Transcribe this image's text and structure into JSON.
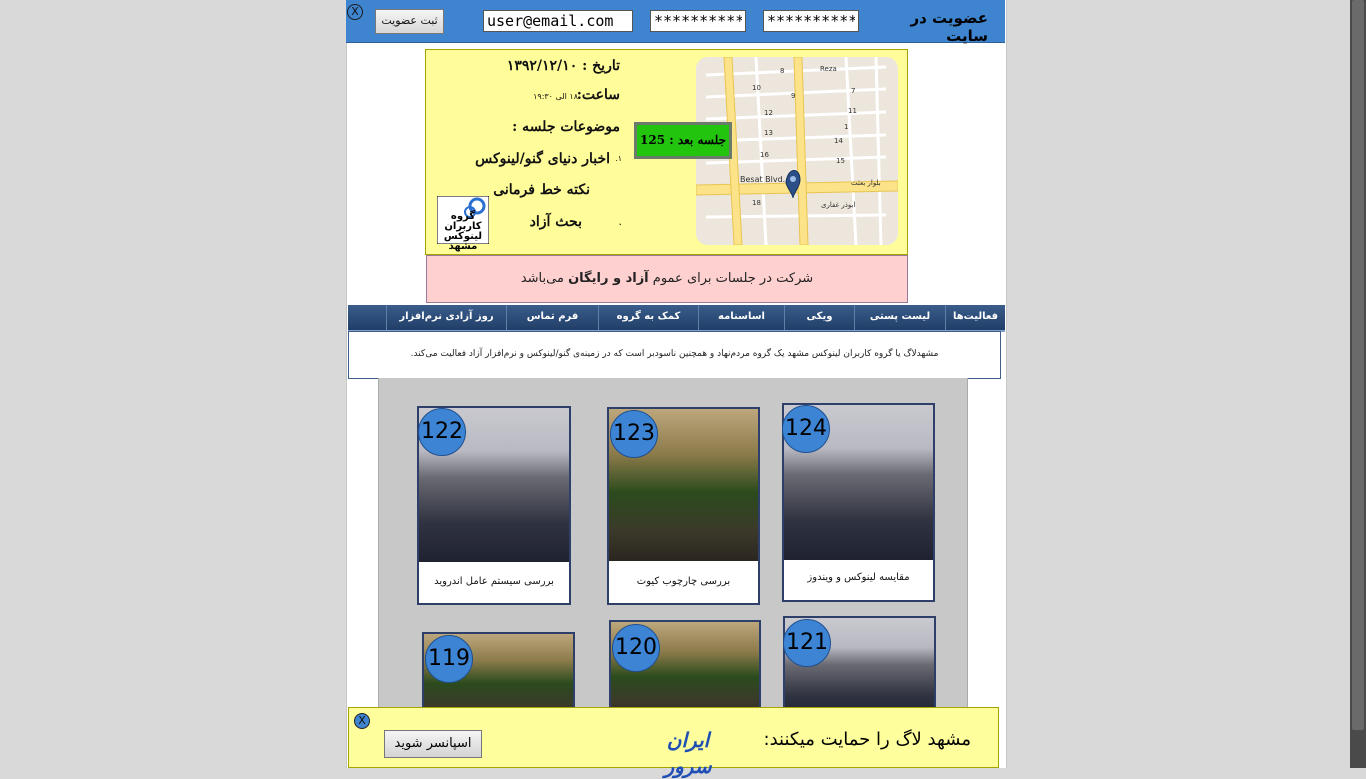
{
  "header": {
    "close_label": "X",
    "register_button": "ثبت عضویت",
    "email_value": "user@email.com",
    "password1_value": "**********",
    "password2_value": "**********",
    "title": "عضویت در سایت"
  },
  "session": {
    "date_label": "تاریخ : ۱۳۹۲/۱۲/۱۰",
    "time_label": "ساعت:",
    "time_value": "۱۸ الی ۱۹:۳۰",
    "topics_label": "موضوعات جلسه :",
    "topic_1": "اخبار دنیای گنو/لینوکس",
    "topic_1_num": "۱.",
    "topic_2": "نکته خط فرمانی",
    "topic_3": "بحث آزاد",
    "topic_3_num": ".",
    "next_session": "جلسه بعد : 125",
    "logo_text": "گروه کاربران لینوکس مشهد"
  },
  "map": {
    "street_1": "Besat Blvd.",
    "street_2": "بلوار بعثت",
    "street_3": "ابوذر غفاری",
    "street_4": "Reza",
    "numbers": [
      "8",
      "10",
      "9",
      "7",
      "12",
      "11",
      "13",
      "14",
      "16",
      "15",
      "18",
      "1"
    ]
  },
  "notice": {
    "text_before": "شرکت در جلسات برای عموم",
    "text_bold": "آزاد و رایگان",
    "text_after": "می‌باشد"
  },
  "nav": {
    "items": [
      "فعالیت‌ها",
      "لیست پستی",
      "ویکی",
      "اساسنامه",
      "کمک به گروه",
      "فرم تماس",
      "روز آزادی نرم‌افزار"
    ]
  },
  "about": {
    "text": "مشهدلاگ یا گروه کاربران لینوکس مشهد یک گروه مردم‌نهاد و همچنین ناسودبر است که در زمینه‌ی گنو/لینوکس و نرم‌افزار آزاد فعالیت می‌کند."
  },
  "gallery": {
    "cards": [
      {
        "number": "122",
        "caption": "بررسی سیستم عامل اندروید"
      },
      {
        "number": "123",
        "caption": "بررسی چارچوب کیوت"
      },
      {
        "number": "124",
        "caption": "مقایسه لینوکس و ویندوز"
      },
      {
        "number": "119",
        "caption": ""
      },
      {
        "number": "120",
        "caption": ""
      },
      {
        "number": "121",
        "caption": ""
      }
    ]
  },
  "sponsor": {
    "close_label": "X",
    "button": "اسپانسر شوید",
    "text": "مشهد لاگ را حمایت میکنند:",
    "logo_text": "ایران سرور"
  },
  "colors": {
    "topbar": "#3f84cf",
    "infobox": "#fffd9a",
    "badge": "#22c40e",
    "notice": "#ffd0d0",
    "nav": "#203e67"
  }
}
